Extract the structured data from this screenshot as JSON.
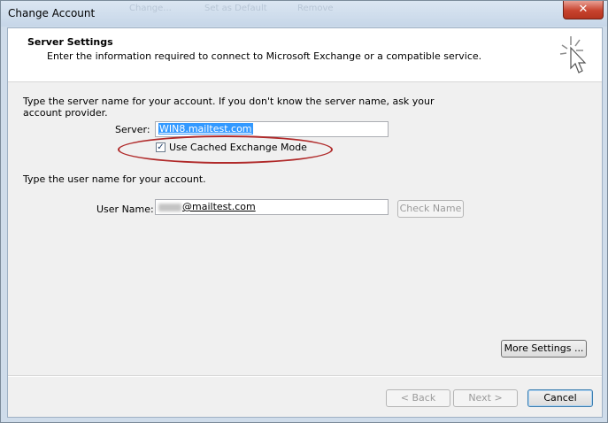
{
  "window": {
    "title": "Change Account",
    "ghost_toolbar": [
      "Change...",
      "Set as Default",
      "Remove"
    ]
  },
  "header": {
    "title": "Server Settings",
    "subtitle": "Enter the information required to connect to Microsoft Exchange or a compatible service.",
    "icon": "wizard-cursor-icon"
  },
  "server_section": {
    "instructions_line1": "Type the server name for your account. If you don't know the server name, ask your",
    "instructions_line2": "account provider.",
    "server_label": "Server:",
    "server_value": "WIN8.mailtest.com",
    "cached_mode_label": "Use Cached Exchange Mode",
    "cached_mode_checked": true
  },
  "user_section": {
    "instructions": "Type the user name for your account.",
    "user_label": "User Name:",
    "user_value_visible": "@mailtest.com",
    "check_name_label": "Check Name"
  },
  "buttons": {
    "more_settings": "More Settings ...",
    "back": "< Back",
    "next": "Next >",
    "cancel": "Cancel"
  },
  "colors": {
    "highlight_oval": "#b02a2a",
    "selection": "#3399ff",
    "close_button": "#c7432e"
  }
}
